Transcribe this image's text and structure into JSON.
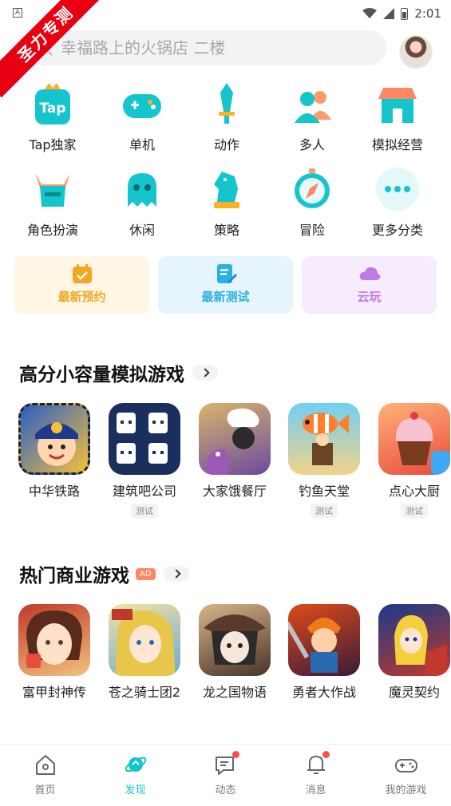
{
  "status_bar": {
    "time": "2:01",
    "notif_icon": "A"
  },
  "ribbon": {
    "text": "圣力专测"
  },
  "search": {
    "placeholder": "幸福路上的火锅店 二楼"
  },
  "categories": [
    {
      "label": "Tap独家",
      "icon": "tap-logo-icon"
    },
    {
      "label": "单机",
      "icon": "gamepad-icon"
    },
    {
      "label": "动作",
      "icon": "sword-icon"
    },
    {
      "label": "多人",
      "icon": "people-icon"
    },
    {
      "label": "模拟经营",
      "icon": "shop-icon"
    },
    {
      "label": "角色扮演",
      "icon": "helmet-icon"
    },
    {
      "label": "休闲",
      "icon": "ghost-icon"
    },
    {
      "label": "策略",
      "icon": "chess-knight-icon"
    },
    {
      "label": "冒险",
      "icon": "compass-icon"
    },
    {
      "label": "更多分类",
      "icon": "more-dots-icon"
    }
  ],
  "tap_logo_text": "Tap",
  "quick_entries": [
    {
      "label": "最新预约",
      "color": "#f5a623",
      "bg": "#fff6e3"
    },
    {
      "label": "最新测试",
      "color": "#2bb0e6",
      "bg": "#e6f5fd"
    },
    {
      "label": "云玩",
      "color": "#c07ae6",
      "bg": "#f7ecfd"
    }
  ],
  "section1": {
    "title": "高分小容量模拟游戏",
    "games": [
      {
        "name": "中华铁路",
        "tag": ""
      },
      {
        "name": "建筑吧公司",
        "tag": "测试"
      },
      {
        "name": "大家饿餐厅",
        "tag": ""
      },
      {
        "name": "钓鱼天堂",
        "tag": "测试"
      },
      {
        "name": "点心大厨",
        "tag": "测试"
      }
    ]
  },
  "section2": {
    "title": "热门商业游戏",
    "ad": "AD",
    "games": [
      {
        "name": "富甲封神传"
      },
      {
        "name": "苍之骑士团2"
      },
      {
        "name": "龙之国物语"
      },
      {
        "name": "勇者大作战"
      },
      {
        "name": "魔灵契约"
      }
    ]
  },
  "tabs": [
    {
      "label": "首页",
      "icon": "home-icon",
      "active": false,
      "dot": false
    },
    {
      "label": "发现",
      "icon": "discover-planet-icon",
      "active": true,
      "dot": false
    },
    {
      "label": "动态",
      "icon": "feed-icon",
      "active": false,
      "dot": true
    },
    {
      "label": "消息",
      "icon": "bell-icon",
      "active": false,
      "dot": true
    },
    {
      "label": "我的游戏",
      "icon": "my-games-gamepad-icon",
      "active": false,
      "dot": false
    }
  ],
  "colors": {
    "accent": "#15c5ce",
    "badge_red": "#ff4d4f",
    "ribbon_red": "#e60012"
  }
}
